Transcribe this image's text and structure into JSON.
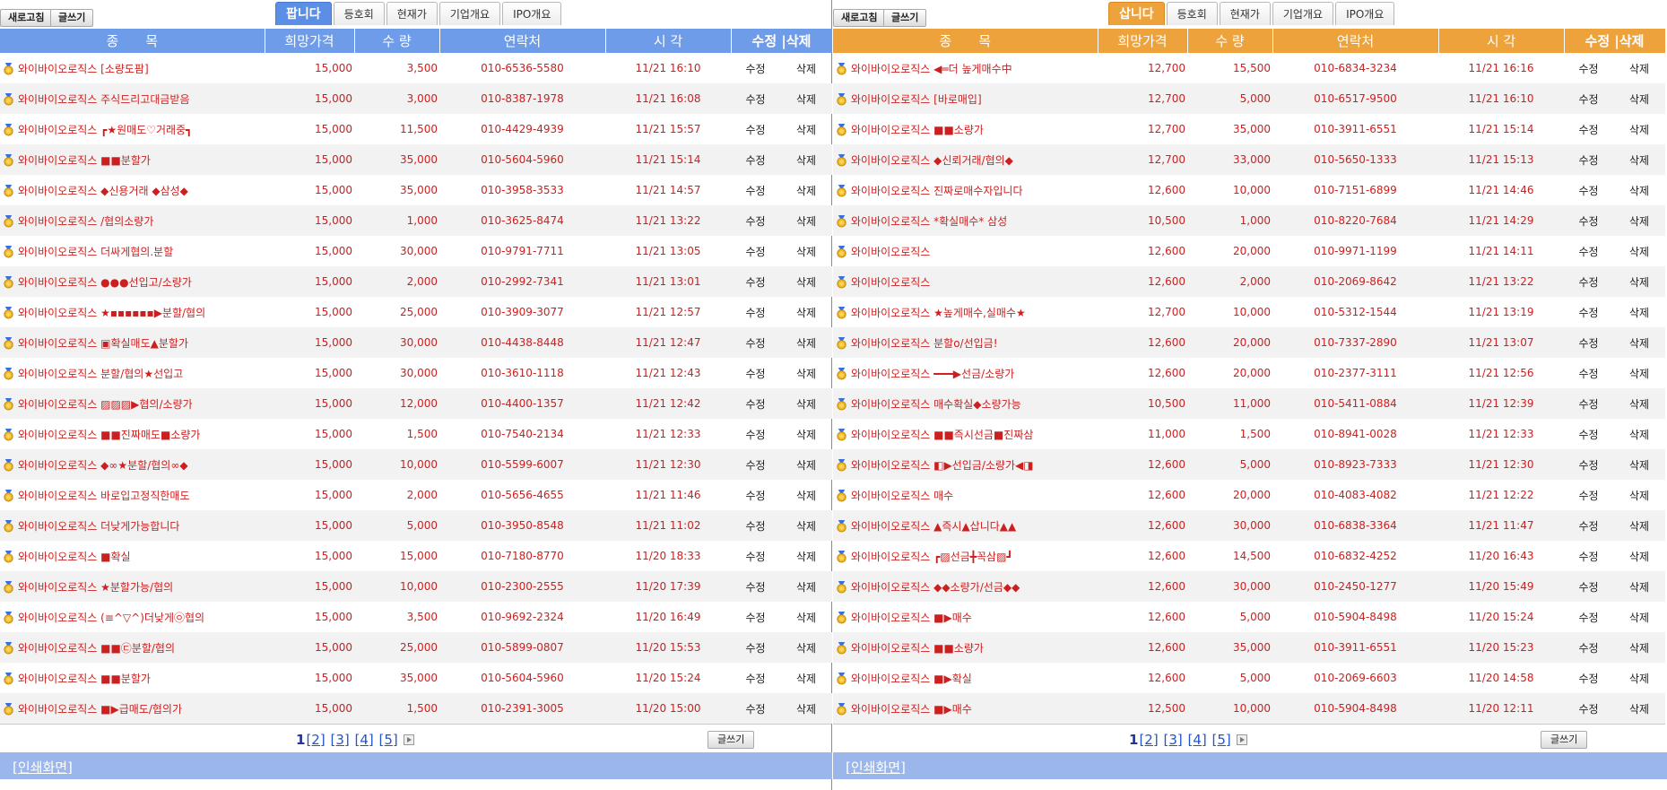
{
  "top_buttons": {
    "refresh": "새로고침",
    "write": "글쓰기"
  },
  "tabs": [
    "팝니다",
    "삽니다",
    "등호회",
    "현재가",
    "기업개요",
    "IPO개요"
  ],
  "columns": {
    "name": "종　　목",
    "price": "희망가격",
    "qty": "수 량",
    "contact": "연락처",
    "time": "시 각",
    "actions": "수정 |삭제"
  },
  "actions": {
    "edit": "수정",
    "delete": "삭제"
  },
  "stock_name": "와이바이오로직스",
  "icon": "medal-coin-icon",
  "colors": {
    "sell_accent": "#6f9ce9",
    "buy_accent": "#eea23b",
    "row_text": "#cc1f1f"
  },
  "pager": {
    "current": "1",
    "pages": [
      "[2]",
      "[3]",
      "[4]",
      "[5]"
    ]
  },
  "print_label": "[인쇄화면]",
  "sell": {
    "active_tab": "팝니다",
    "rows": [
      {
        "name": "와이바이오로직스 [소량도팜]",
        "price": "15,000",
        "qty": "3,500",
        "contact": "010-6536-5580",
        "time": "11/21 16:10"
      },
      {
        "name": "와이바이오로직스 주식드리고대금받음",
        "price": "15,000",
        "qty": "3,000",
        "contact": "010-8387-1978",
        "time": "11/21 16:08"
      },
      {
        "name": "와이바이오로직스 ┏★원매도♡거래중┓",
        "price": "15,000",
        "qty": "11,500",
        "contact": "010-4429-4939",
        "time": "11/21 15:57"
      },
      {
        "name": "와이바이오로직스 ■■분할가",
        "price": "15,000",
        "qty": "35,000",
        "contact": "010-5604-5960",
        "time": "11/21 15:14"
      },
      {
        "name": "와이바이오로직스 ◆신용거래 ◆삼성◆",
        "price": "15,000",
        "qty": "35,000",
        "contact": "010-3958-3533",
        "time": "11/21 14:57"
      },
      {
        "name": "와이바이오로직스 /협의소량가",
        "price": "15,000",
        "qty": "1,000",
        "contact": "010-3625-8474",
        "time": "11/21 13:22"
      },
      {
        "name": "와이바이오로직스 더싸게협의.분할",
        "price": "15,000",
        "qty": "30,000",
        "contact": "010-9791-7711",
        "time": "11/21 13:05"
      },
      {
        "name": "와이바이오로직스 ●●●선입고/소량가",
        "price": "15,000",
        "qty": "2,000",
        "contact": "010-2992-7341",
        "time": "11/21 13:01"
      },
      {
        "name": "와이바이오로직스 ★▪▪▪▪▪▪▶분할/협의",
        "price": "15,000",
        "qty": "25,000",
        "contact": "010-3909-3077",
        "time": "11/21 12:57"
      },
      {
        "name": "와이바이오로직스 ▣확실매도▲분할가",
        "price": "15,000",
        "qty": "30,000",
        "contact": "010-4438-8448",
        "time": "11/21 12:47"
      },
      {
        "name": "와이바이오로직스 분할/협의★선입고",
        "price": "15,000",
        "qty": "30,000",
        "contact": "010-3610-1118",
        "time": "11/21 12:43"
      },
      {
        "name": "와이바이오로직스 ▨▨▨▶협의/소량가",
        "price": "15,000",
        "qty": "12,000",
        "contact": "010-4400-1357",
        "time": "11/21 12:42"
      },
      {
        "name": "와이바이오로직스 ■■진짜매도■소량가",
        "price": "15,000",
        "qty": "1,500",
        "contact": "010-7540-2134",
        "time": "11/21 12:33"
      },
      {
        "name": "와이바이오로직스 ◆∞★분할/협의∞◆",
        "price": "15,000",
        "qty": "10,000",
        "contact": "010-5599-6007",
        "time": "11/21 12:30"
      },
      {
        "name": "와이바이오로직스 바로입고정직한매도",
        "price": "15,000",
        "qty": "2,000",
        "contact": "010-5656-4655",
        "time": "11/21 11:46"
      },
      {
        "name": "와이바이오로직스 더낮게가능합니다",
        "price": "15,000",
        "qty": "5,000",
        "contact": "010-3950-8548",
        "time": "11/21 11:02"
      },
      {
        "name": "와이바이오로직스 ■확실",
        "price": "15,000",
        "qty": "15,000",
        "contact": "010-7180-8770",
        "time": "11/20 18:33"
      },
      {
        "name": "와이바이오로직스 ★분할가능/협의",
        "price": "15,000",
        "qty": "10,000",
        "contact": "010-2300-2555",
        "time": "11/20 17:39"
      },
      {
        "name": "와이바이오로직스 (≡^▽^)더낮게㉧협의",
        "price": "15,000",
        "qty": "3,500",
        "contact": "010-9692-2324",
        "time": "11/20 16:49"
      },
      {
        "name": "와이바이오로직스 ■■㉢분할/협의",
        "price": "15,000",
        "qty": "25,000",
        "contact": "010-5899-0807",
        "time": "11/20 15:53"
      },
      {
        "name": "와이바이오로직스 ■■분할가",
        "price": "15,000",
        "qty": "35,000",
        "contact": "010-5604-5960",
        "time": "11/20 15:24"
      },
      {
        "name": "와이바이오로직스 ■▶급매도/협의가",
        "price": "15,000",
        "qty": "1,500",
        "contact": "010-2391-3005",
        "time": "11/20 15:00"
      }
    ]
  },
  "buy": {
    "active_tab": "삽니다",
    "rows": [
      {
        "name": "와이바이오로직스 ◀═더 높게매수中",
        "price": "12,700",
        "qty": "15,500",
        "contact": "010-6834-3234",
        "time": "11/21 16:16"
      },
      {
        "name": "와이바이오로직스 [바로매입]",
        "price": "12,700",
        "qty": "5,000",
        "contact": "010-6517-9500",
        "time": "11/21 16:10"
      },
      {
        "name": "와이바이오로직스 ■■소량가",
        "price": "12,700",
        "qty": "35,000",
        "contact": "010-3911-6551",
        "time": "11/21 15:14"
      },
      {
        "name": "와이바이오로직스 ◆신뢰거래/협의◆",
        "price": "12,700",
        "qty": "33,000",
        "contact": "010-5650-1333",
        "time": "11/21 15:13"
      },
      {
        "name": "와이바이오로직스 진짜로매수자입니다",
        "price": "12,600",
        "qty": "10,000",
        "contact": "010-7151-6899",
        "time": "11/21 14:46"
      },
      {
        "name": "와이바이오로직스 *확실매수* 삼성",
        "price": "10,500",
        "qty": "1,000",
        "contact": "010-8220-7684",
        "time": "11/21 14:29"
      },
      {
        "name": "와이바이오로직스",
        "price": "12,600",
        "qty": "20,000",
        "contact": "010-9971-1199",
        "time": "11/21 14:11"
      },
      {
        "name": "와이바이오로직스",
        "price": "12,600",
        "qty": "2,000",
        "contact": "010-2069-8642",
        "time": "11/21 13:22"
      },
      {
        "name": "와이바이오로직스 ★높게매수,실매수★",
        "price": "12,700",
        "qty": "10,000",
        "contact": "010-5312-1544",
        "time": "11/21 13:19"
      },
      {
        "name": "와이바이오로직스 분할o/선입금!",
        "price": "12,600",
        "qty": "20,000",
        "contact": "010-7337-2890",
        "time": "11/21 13:07"
      },
      {
        "name": "와이바이오로직스 ━━━▶선금/소량가",
        "price": "12,600",
        "qty": "20,000",
        "contact": "010-2377-3111",
        "time": "11/21 12:56"
      },
      {
        "name": "와이바이오로직스 매수확실◆소량가능",
        "price": "10,500",
        "qty": "11,000",
        "contact": "010-5411-0884",
        "time": "11/21 12:39"
      },
      {
        "name": "와이바이오로직스 ■■즉시선금■진짜삼",
        "price": "11,000",
        "qty": "1,500",
        "contact": "010-8941-0028",
        "time": "11/21 12:33"
      },
      {
        "name": "와이바이오로직스 ◧▶선입금/소량가◀◨",
        "price": "12,600",
        "qty": "5,000",
        "contact": "010-8923-7333",
        "time": "11/21 12:30"
      },
      {
        "name": "와이바이오로직스 매수",
        "price": "12,600",
        "qty": "20,000",
        "contact": "010-4083-4082",
        "time": "11/21 12:22"
      },
      {
        "name": "와이바이오로직스 ▲즉시▲삽니다▲▲",
        "price": "12,600",
        "qty": "30,000",
        "contact": "010-6838-3364",
        "time": "11/21 11:47"
      },
      {
        "name": "와이바이오로직스 ┏▨선금╋꼭삼▨┛",
        "price": "12,600",
        "qty": "14,500",
        "contact": "010-6832-4252",
        "time": "11/20 16:43"
      },
      {
        "name": "와이바이오로직스 ◆◆소량가/선금◆◆",
        "price": "12,600",
        "qty": "30,000",
        "contact": "010-2450-1277",
        "time": "11/20 15:49"
      },
      {
        "name": "와이바이오로직스 ■▶매수",
        "price": "12,600",
        "qty": "5,000",
        "contact": "010-5904-8498",
        "time": "11/20 15:24"
      },
      {
        "name": "와이바이오로직스 ■■소량가",
        "price": "12,600",
        "qty": "35,000",
        "contact": "010-3911-6551",
        "time": "11/20 15:23"
      },
      {
        "name": "와이바이오로직스 ■▶확실",
        "price": "12,600",
        "qty": "5,000",
        "contact": "010-2069-6603",
        "time": "11/20 14:58"
      },
      {
        "name": "와이바이오로직스 ■▶매수",
        "price": "12,500",
        "qty": "10,000",
        "contact": "010-5904-8498",
        "time": "11/20 12:11"
      }
    ]
  }
}
